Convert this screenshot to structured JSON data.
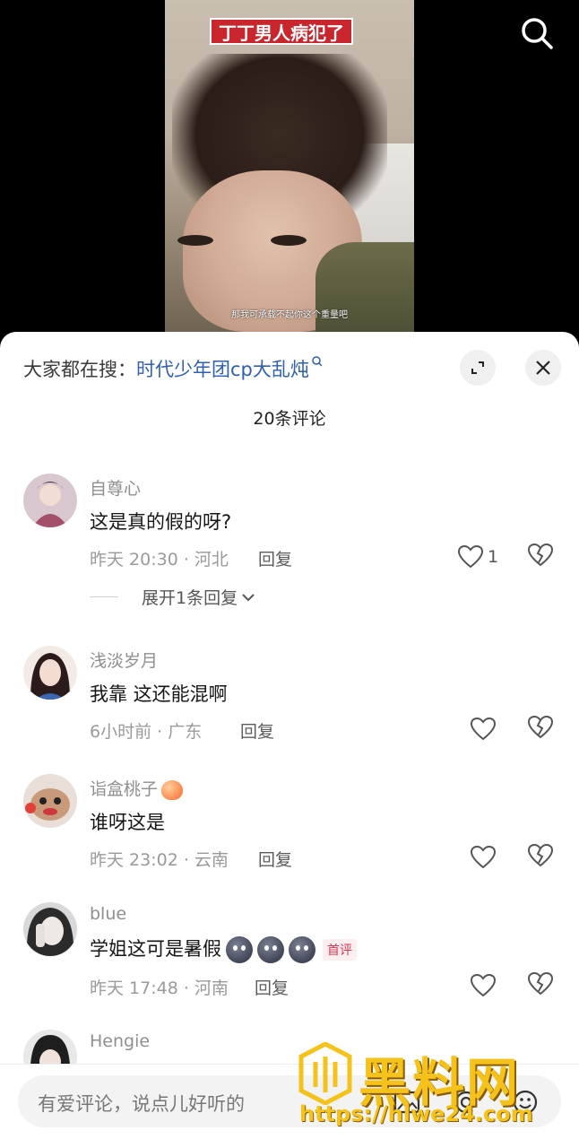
{
  "video": {
    "title_caption": "丁丁男人病犯了",
    "subtitle": "那我可承载不起你这个重量吧"
  },
  "sheet": {
    "search_prefix": "大家都在搜",
    "search_sep": "：",
    "search_link": "时代少年团cp大乱炖",
    "comment_count": "20条评论"
  },
  "comments": [
    {
      "name": "自尊心",
      "text": "这是真的假的呀?",
      "meta": "昨天 20:30 · 河北",
      "reply": "回复",
      "likes": "1",
      "expand": "展开1条回复"
    },
    {
      "name": "浅淡岁月",
      "text": "我靠 这还能混啊",
      "meta": "6小时前 · 广东",
      "reply": "回复"
    },
    {
      "name": "诣盒桃子",
      "text": "谁呀这是",
      "meta": "昨天 23:02 · 云南",
      "reply": "回复"
    },
    {
      "name": "blue",
      "text": "学姐这可是暑假",
      "badge": "首评",
      "meta": "昨天 17:48 · 河南",
      "reply": "回复"
    },
    {
      "name": "Hengie"
    }
  ],
  "input": {
    "placeholder": "有爱评论，说点儿好听的"
  },
  "watermark": {
    "title": "黑料网",
    "url": "https://hlwe24.com"
  },
  "colors": {
    "link": "#2f5fb2",
    "badge": "#e0334e",
    "caption_bg": "#c8252c"
  }
}
